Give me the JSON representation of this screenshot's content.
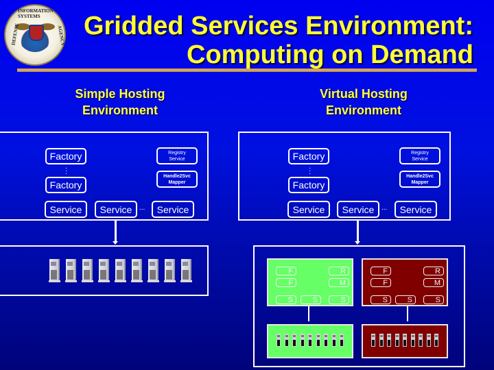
{
  "title": {
    "line1": "Gridded Services Environment:",
    "line2": "Computing on Demand"
  },
  "logo": {
    "top_text": "INFORMATION SYSTEMS",
    "left_text": "DEFENSE",
    "right_text": "AGENCY",
    "icon": "disa-seal-icon"
  },
  "simple": {
    "heading_line1": "Simple Hosting",
    "heading_line2": "Environment",
    "factory1": "Factory",
    "factory2": "Factory",
    "vdots": ":",
    "registry_line1": "Registry",
    "registry_line2": "Service",
    "mapper_line1": "Handle2Svc",
    "mapper_line2": "Mapper",
    "service1": "Service",
    "service2": "Service",
    "service3": "Service",
    "ellipsis": "...",
    "server_count": 9
  },
  "virtual": {
    "heading_line1": "Virtual Hosting",
    "heading_line2": "Environment",
    "factory1": "Factory",
    "factory2": "Factory",
    "vdots": ":",
    "registry_line1": "Registry",
    "registry_line2": "Service",
    "mapper_line1": "Handle2Svc",
    "mapper_line2": "Mapper",
    "service1": "Service",
    "service2": "Service",
    "service3": "Service",
    "ellipsis": "...",
    "environments": [
      {
        "color": "#66ff66",
        "f1": "F",
        "f2": "F",
        "r": "R",
        "m": "M",
        "s1": "S",
        "s2": "S",
        "s3": "S",
        "server_count": 9
      },
      {
        "color": "#800000",
        "f1": "F",
        "f2": "F",
        "r": "R",
        "m": "M",
        "s1": "S",
        "s2": "S",
        "s3": "S",
        "server_count": 9
      }
    ]
  },
  "colors": {
    "title": "#ffff33",
    "rule": "#d4a460",
    "green_env": "#66ff66",
    "red_env": "#800000"
  }
}
